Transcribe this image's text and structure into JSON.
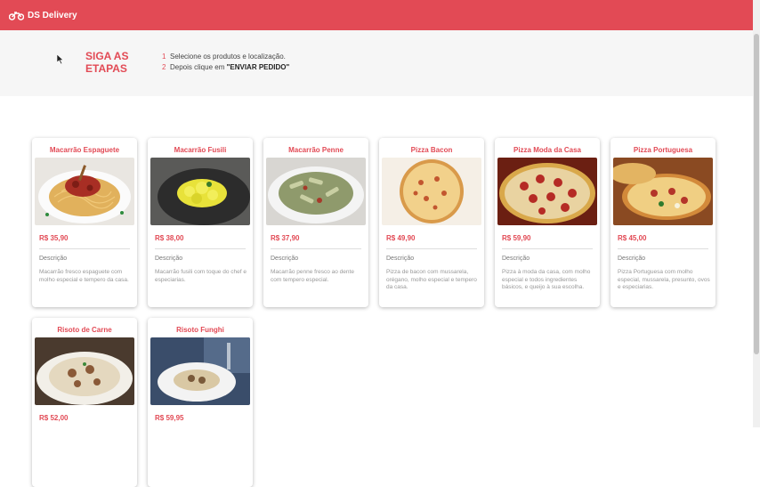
{
  "navbar": {
    "brand": "DS Delivery",
    "brand_icon": "motorcycle-icon",
    "color": "#e24a55"
  },
  "steps": {
    "title": "SIGA AS ETAPAS",
    "items": [
      {
        "number": "1",
        "text": "Selecione os produtos e localização.",
        "strong": ""
      },
      {
        "number": "2",
        "text": "Depois clique em ",
        "strong": "\"ENVIAR PEDIDO\""
      }
    ]
  },
  "products": [
    {
      "name": "Macarrão Espaguete",
      "price": "R$ 35,90",
      "description_label": "Descrição",
      "description": "Macarrão fresco espaguete com molho especial e tempero da casa."
    },
    {
      "name": "Macarrão Fusili",
      "price": "R$ 38,00",
      "description_label": "Descrição",
      "description": "Macarrão fusili com toque do chef e especiarias."
    },
    {
      "name": "Macarrão Penne",
      "price": "R$ 37,90",
      "description_label": "Descrição",
      "description": "Macarrão penne fresco ao dente com tempero especial."
    },
    {
      "name": "Pizza Bacon",
      "price": "R$ 49,90",
      "description_label": "Descrição",
      "description": "Pizza de bacon com mussarela, orégano, molho especial e tempero da casa."
    },
    {
      "name": "Pizza Moda da Casa",
      "price": "R$ 59,90",
      "description_label": "Descrição",
      "description": "Pizza à moda da casa, com molho especial e todos ingredientes básicos, e queijo à sua escolha."
    },
    {
      "name": "Pizza Portuguesa",
      "price": "R$ 45,00",
      "description_label": "Descrição",
      "description": "Pizza Portuguesa com molho especial, mussarela, presunto, ovos e especiarias."
    },
    {
      "name": "Risoto de Carne",
      "price": "R$ 52,00",
      "description_label": "",
      "description": ""
    },
    {
      "name": "Risoto Funghi",
      "price": "R$ 59,95",
      "description_label": "",
      "description": ""
    }
  ]
}
